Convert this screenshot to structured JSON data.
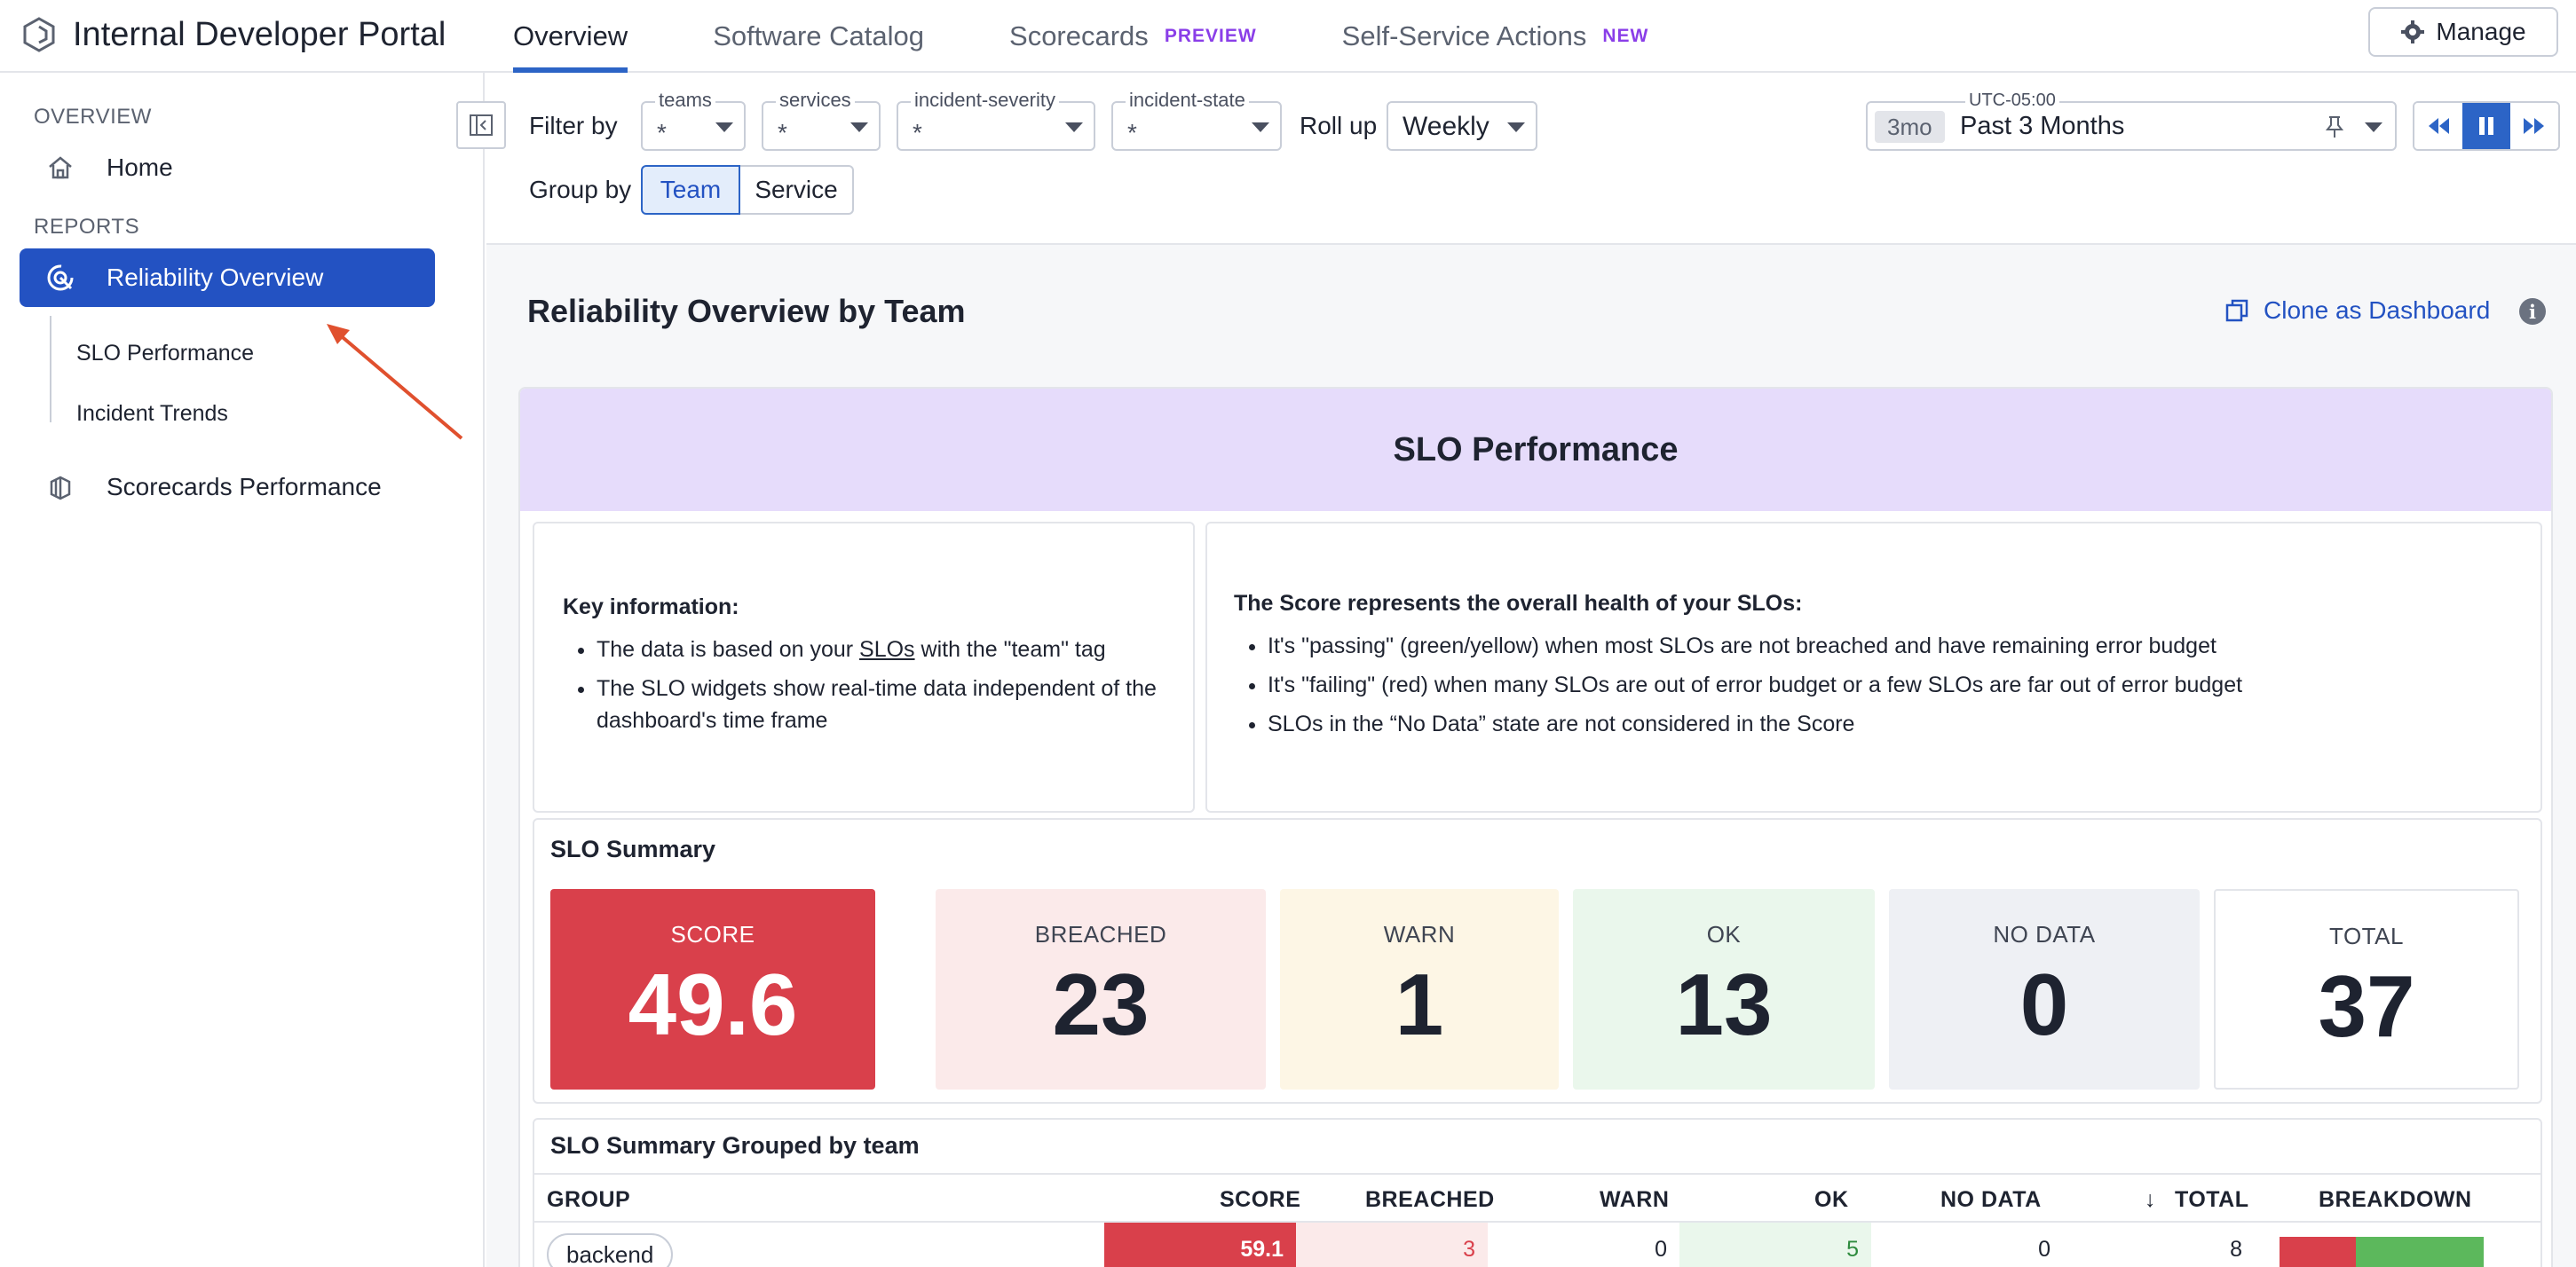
{
  "app": {
    "title": "Internal Developer Portal",
    "logo_icon": "hexagon-logo-icon"
  },
  "nav": {
    "tabs": [
      {
        "label": "Overview",
        "active": true,
        "badge": ""
      },
      {
        "label": "Software Catalog",
        "active": false,
        "badge": ""
      },
      {
        "label": "Scorecards",
        "active": false,
        "badge": "PREVIEW"
      },
      {
        "label": "Self-Service Actions",
        "active": false,
        "badge": "NEW"
      }
    ],
    "manage_label": "Manage"
  },
  "sidebar": {
    "overview_heading": "OVERVIEW",
    "home_label": "Home",
    "reports_heading": "REPORTS",
    "reliability_label": "Reliability Overview",
    "sub_items": [
      "SLO Performance",
      "Incident Trends"
    ],
    "scorecards_label": "Scorecards Performance"
  },
  "filters": {
    "filter_by_label": "Filter by",
    "teams": {
      "legend": "teams",
      "value": "*"
    },
    "services": {
      "legend": "services",
      "value": "*"
    },
    "incident_severity": {
      "legend": "incident-severity",
      "value": "*"
    },
    "incident_state": {
      "legend": "incident-state",
      "value": "*"
    },
    "rollup_label": "Roll up",
    "rollup_value": "Weekly",
    "group_by_label": "Group by",
    "group_options": [
      "Team",
      "Service"
    ],
    "group_selected": "Team",
    "time": {
      "timezone": "UTC-05:00",
      "chip": "3mo",
      "value": "Past 3 Months"
    }
  },
  "report": {
    "title": "Reliability Overview by Team",
    "clone_label": "Clone as Dashboard",
    "banner": "SLO Performance",
    "key_info": {
      "heading": "Key information:",
      "bullet1_prefix": "The data is based on your ",
      "bullet1_link": "SLOs",
      "bullet1_suffix": " with the \"team\" tag",
      "bullet2": "The SLO widgets show real-time data independent of the dashboard's time frame"
    },
    "score_info": {
      "heading": "The Score represents the overall health of your SLOs:",
      "bullets": [
        "It's \"passing\" (green/yellow) when most SLOs are not breached and have remaining error budget",
        "It's \"failing\" (red) when many SLOs are out of error budget or a few SLOs are far out of error budget",
        "SLOs in the “No Data” state are not considered in the Score"
      ]
    },
    "summary": {
      "title": "SLO Summary",
      "tiles": [
        {
          "label": "SCORE",
          "value": "49.6"
        },
        {
          "label": "BREACHED",
          "value": "23"
        },
        {
          "label": "WARN",
          "value": "1"
        },
        {
          "label": "OK",
          "value": "13"
        },
        {
          "label": "NO DATA",
          "value": "0"
        },
        {
          "label": "TOTAL",
          "value": "37"
        }
      ]
    },
    "grouped": {
      "title": "SLO Summary Grouped by team",
      "columns": [
        "GROUP",
        "SCORE",
        "BREACHED",
        "WARN",
        "OK",
        "NO DATA",
        "TOTAL",
        "BREAKDOWN"
      ],
      "sort_column": "TOTAL",
      "rows": [
        {
          "group": "backend",
          "score": "59.1",
          "breached": "3",
          "warn": "0",
          "ok": "5",
          "no_data": "0",
          "total": "8"
        }
      ]
    }
  },
  "colors": {
    "accent": "#2352c2",
    "score_red": "#d9404b",
    "breached_bg": "#fbeaea",
    "warn_bg": "#fdf6e5",
    "ok_bg": "#eaf7ec",
    "nodata_bg": "#eef0f4",
    "banner": "#e6dcfb"
  }
}
